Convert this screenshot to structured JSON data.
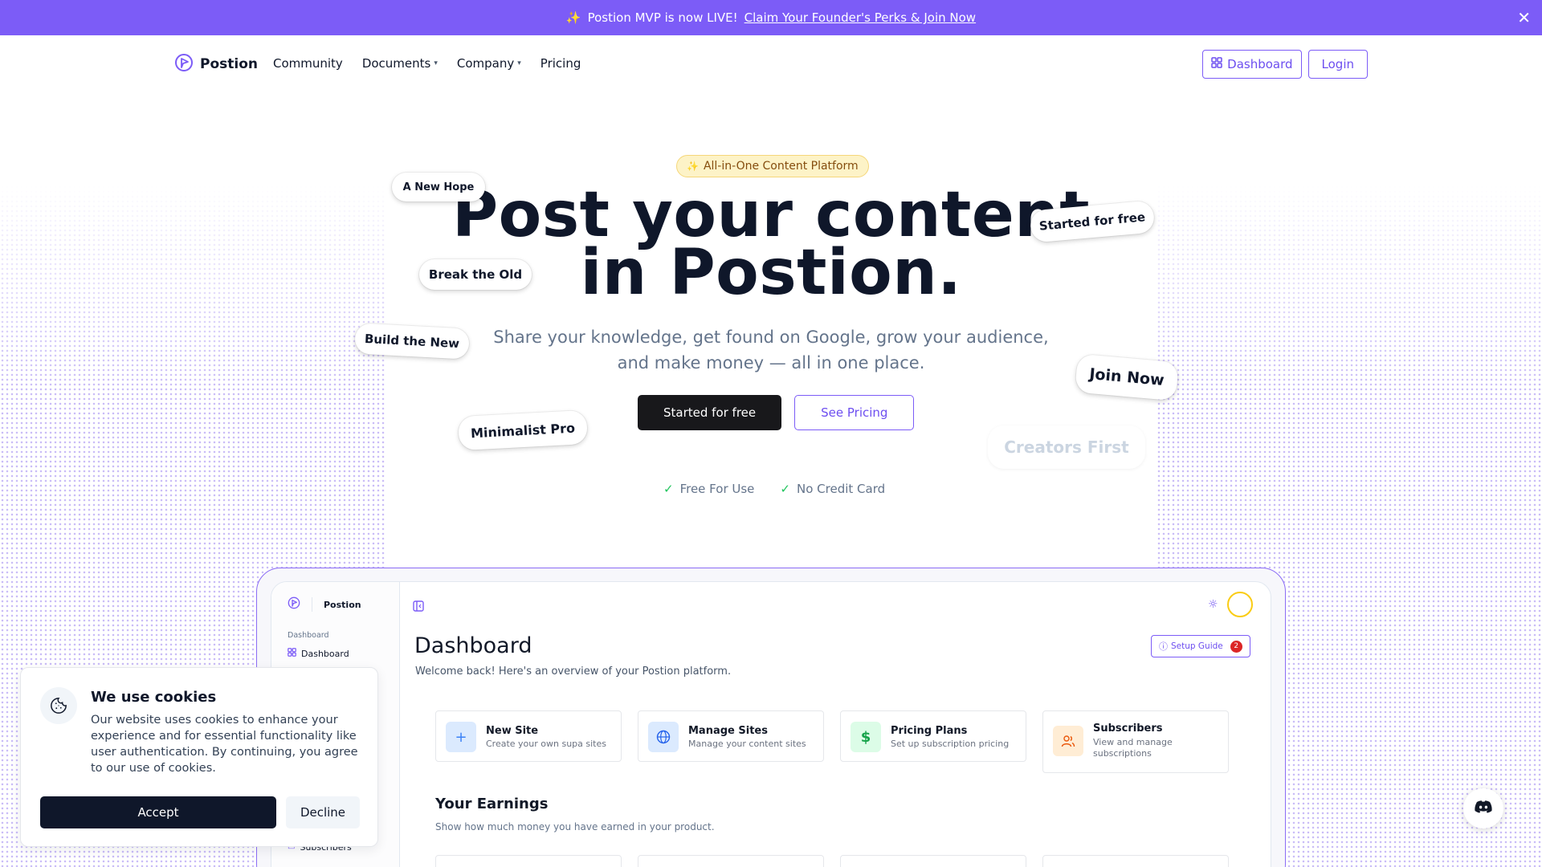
{
  "announcement": {
    "text": "Postion MVP is now LIVE!",
    "link": "Claim Your Founder's Perks & Join Now"
  },
  "nav": {
    "brand": "Postion",
    "links": [
      "Community",
      "Documents",
      "Company",
      "Pricing"
    ],
    "dashboard": "Dashboard",
    "login": "Login"
  },
  "hero": {
    "pill": "All-in-One Content Platform",
    "title_line1": "Post your content",
    "title_line2": "in Postion.",
    "subtitle_line1": "Share your knowledge, get found on Google, grow your audience,",
    "subtitle_line2": "and make money — all in one place.",
    "primary_cta": "Started for free",
    "secondary_cta": "See Pricing",
    "checks": [
      "Free For Use",
      "No Credit Card"
    ]
  },
  "tags": [
    "A New Hope",
    "Break the Old",
    "Build the New",
    "Minimalist Pro",
    "Started for free",
    "Join Now",
    "Creators First"
  ],
  "preview": {
    "brand": "Postion",
    "side_section": "Dashboard",
    "side_item": "Dashboard",
    "side_item_bottom": "Subscribers",
    "title": "Dashboard",
    "subtitle": "Welcome back! Here's an overview of your Postion platform.",
    "setup_guide": "Setup Guide",
    "setup_count": "2",
    "cards": [
      {
        "title": "New Site",
        "sub": "Create your own supa sites",
        "icon": "plus-icon",
        "color": "#3b82f6",
        "bg": "#dbeafe"
      },
      {
        "title": "Manage Sites",
        "sub": "Manage your content sites",
        "icon": "globe-icon",
        "color": "#2563eb",
        "bg": "#dbeafe"
      },
      {
        "title": "Pricing Plans",
        "sub": "Set up subscription pricing",
        "icon": "dollar-icon",
        "color": "#16a34a",
        "bg": "#dcfce7"
      },
      {
        "title": "Subscribers",
        "sub": "View and manage subscriptions",
        "icon": "users-icon",
        "color": "#ea580c",
        "bg": "#ffedd5"
      }
    ],
    "earnings_title": "Your Earnings",
    "earnings_sub": "Show how much money you have earned in your product."
  },
  "cookie": {
    "title": "We use cookies",
    "text": "Our website uses cookies to enhance your experience and for essential functionality like user authentication. By continuing, you agree to our use of cookies.",
    "accept": "Accept",
    "decline": "Decline"
  },
  "colors": {
    "accent": "#7c5cf7",
    "dark": "#18181b"
  }
}
